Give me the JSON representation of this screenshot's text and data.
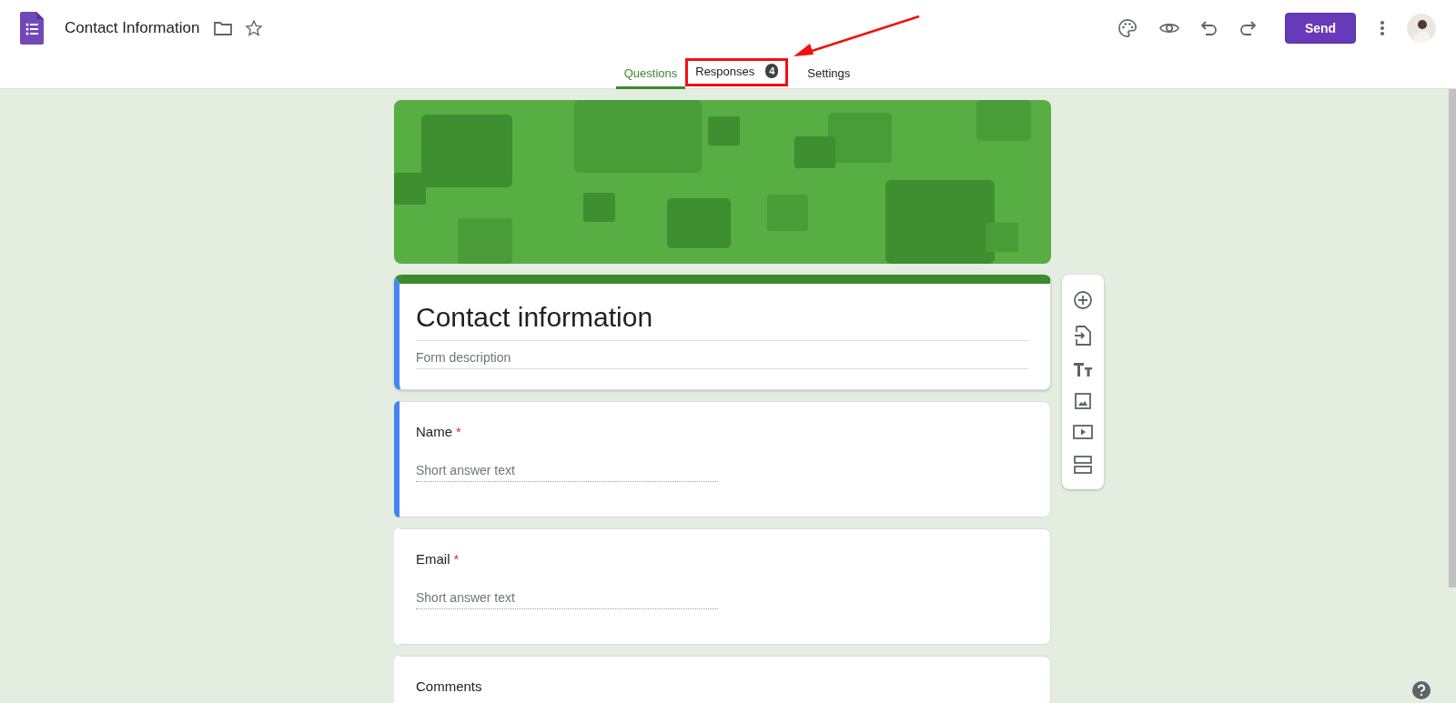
{
  "document": {
    "title": "Contact Information",
    "starred": false
  },
  "toolbar": {
    "send_label": "Send"
  },
  "tabs": [
    {
      "label": "Questions",
      "selected": true
    },
    {
      "label": "Responses",
      "selected": false,
      "badge": "4"
    },
    {
      "label": "Settings",
      "selected": false
    }
  ],
  "form": {
    "title": "Contact information",
    "description_placeholder": "Form description"
  },
  "questions": [
    {
      "title": "Name",
      "required": true,
      "kind": "short_answer",
      "placeholder": "Short answer text",
      "focused": true
    },
    {
      "title": "Email",
      "required": true,
      "kind": "short_answer",
      "placeholder": "Short answer text",
      "focused": false
    },
    {
      "title": "Comments",
      "required": false,
      "kind": "cut_off",
      "focused": false
    }
  ],
  "required_mark": "*"
}
